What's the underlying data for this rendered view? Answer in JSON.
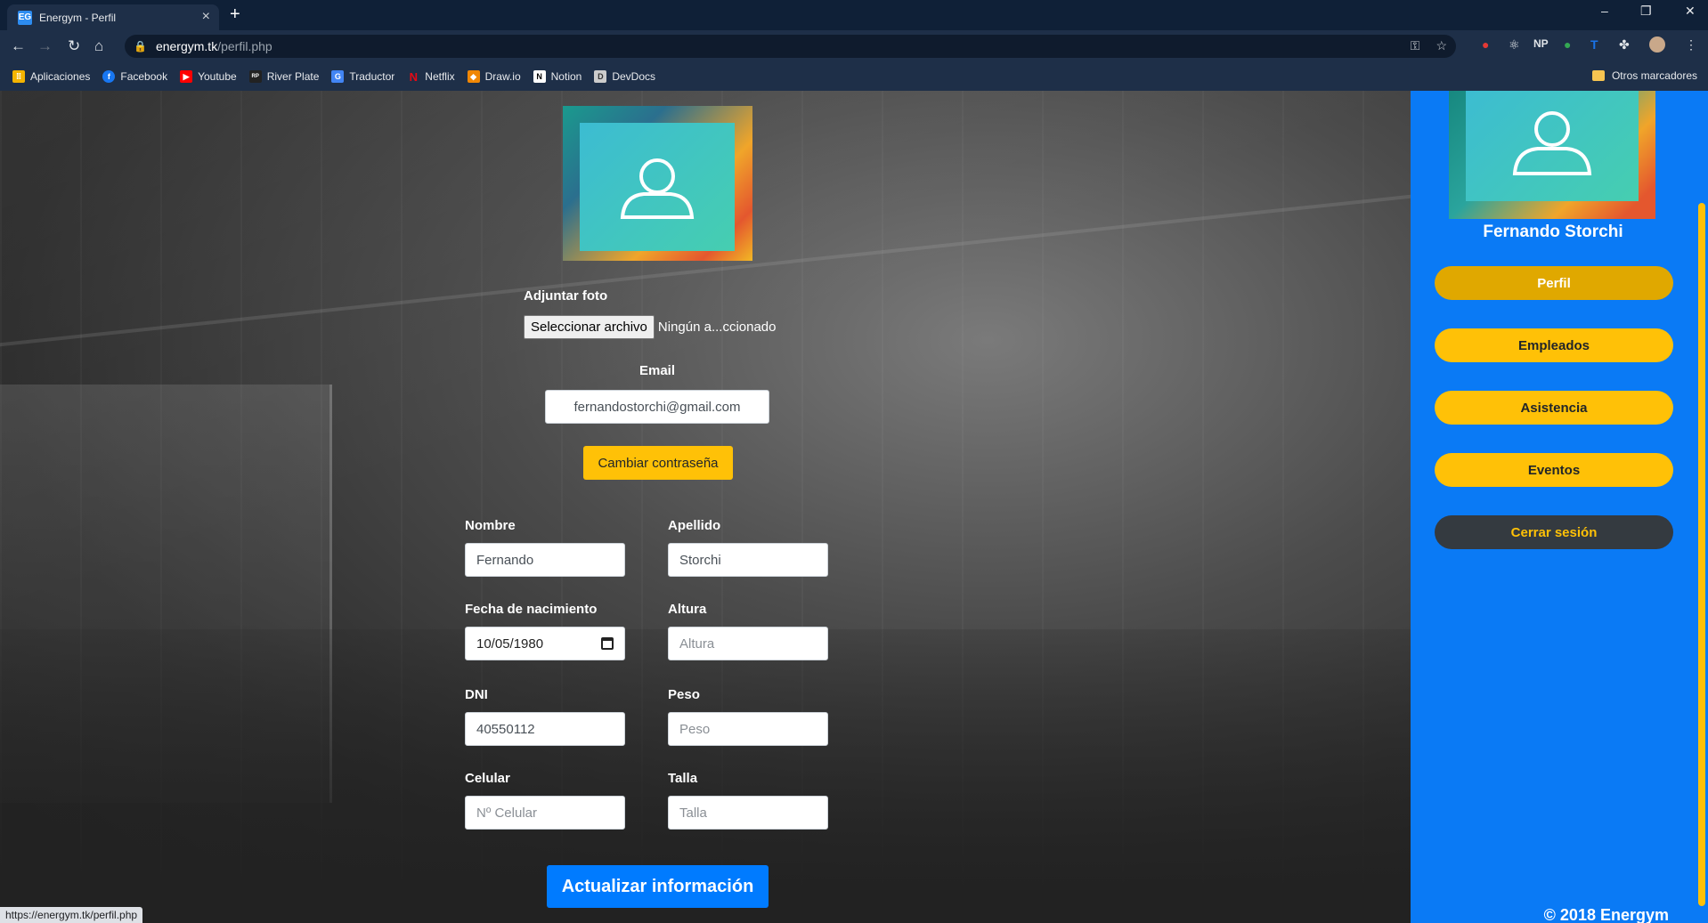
{
  "browser": {
    "tab_title": "Energym - Perfil",
    "url_host": "energym.tk",
    "url_path": "/perfil.php",
    "status_url": "https://energym.tk/perfil.php",
    "bookmarks": [
      {
        "label": "Aplicaciones",
        "icon": "apps-grid-icon",
        "color": "#f4b400"
      },
      {
        "label": "Facebook",
        "icon": "facebook-icon",
        "color": "#1877f2"
      },
      {
        "label": "Youtube",
        "icon": "youtube-icon",
        "color": "#ff0000"
      },
      {
        "label": "River Plate",
        "icon": "riverplate-icon",
        "color": "#222222"
      },
      {
        "label": "Traductor",
        "icon": "translate-icon",
        "color": "#4285f4"
      },
      {
        "label": "Netflix",
        "icon": "netflix-icon",
        "color": "#e50914"
      },
      {
        "label": "Draw.io",
        "icon": "drawio-icon",
        "color": "#f08705"
      },
      {
        "label": "Notion",
        "icon": "notion-icon",
        "color": "#ffffff"
      },
      {
        "label": "DevDocs",
        "icon": "devdocs-icon",
        "color": "#cccccc"
      }
    ],
    "other_bookmarks": "Otros marcadores"
  },
  "form": {
    "photo_label": "Adjuntar foto",
    "file_button": "Seleccionar archivo",
    "file_status": "Ningún a...ccionado",
    "email_label": "Email",
    "email_value": "fernandostorchi@gmail.com",
    "change_password": "Cambiar contraseña",
    "nombre_label": "Nombre",
    "nombre_value": "Fernando",
    "apellido_label": "Apellido",
    "apellido_value": "Storchi",
    "fecha_label": "Fecha de nacimiento",
    "fecha_value": "10/05/1980",
    "altura_label": "Altura",
    "altura_placeholder": "Altura",
    "dni_label": "DNI",
    "dni_value": "40550112",
    "peso_label": "Peso",
    "peso_placeholder": "Peso",
    "celular_label": "Celular",
    "celular_placeholder": "Nº Celular",
    "talla_label": "Talla",
    "talla_placeholder": "Talla",
    "submit": "Actualizar información"
  },
  "sidebar": {
    "user_name": "Fernando Storchi",
    "items": [
      {
        "label": "Perfil"
      },
      {
        "label": "Empleados"
      },
      {
        "label": "Asistencia"
      },
      {
        "label": "Eventos"
      }
    ],
    "logout": "Cerrar sesión",
    "footer": "© 2018 Energym"
  },
  "colors": {
    "sidebar_bg": "#0a7af5",
    "accent_yellow": "#ffc107",
    "primary_blue": "#007bff"
  }
}
